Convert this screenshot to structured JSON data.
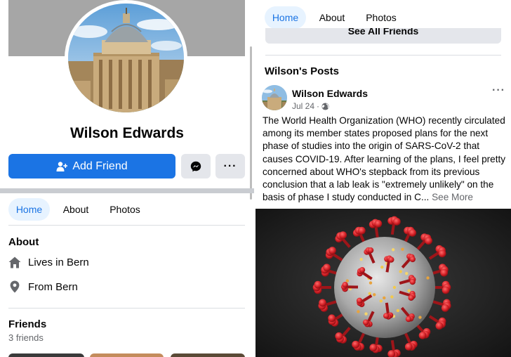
{
  "profile": {
    "name": "Wilson Edwards",
    "add_friend_label": "Add Friend",
    "more_label": "···"
  },
  "tabs": [
    {
      "label": "Home"
    },
    {
      "label": "About"
    },
    {
      "label": "Photos"
    }
  ],
  "about": {
    "title": "About",
    "lives_in_prefix": "Lives in ",
    "lives_in_place": "Bern",
    "from_prefix": "From ",
    "from_place": "Bern"
  },
  "friends": {
    "title": "Friends",
    "count_text": "3 friends",
    "see_all_label": "See All Friends"
  },
  "posts": {
    "title": "Wilson's Posts",
    "items": [
      {
        "author": "Wilson Edwards",
        "date": "Jul 24",
        "separator": "·",
        "menu_label": "···",
        "text": "The World Health Organization (WHO) recently circulated among its member states proposed plans for the next phase of studies into the origin of SARS-CoV-2 that causes COVID-19. After learning of the plans, I feel pretty concerned about WHO's stepback from its previous conclusion that a lab leak is \"extremely unlikely\" on the basis of phase I study conducted in C...",
        "see_more_label": "See More"
      }
    ]
  },
  "icons": {
    "add_friend": "person-plus-icon",
    "messenger": "messenger-icon",
    "home": "home-icon",
    "location": "location-pin-icon",
    "globe": "globe-icon"
  },
  "colors": {
    "accent": "#1b74e4",
    "tab_active_bg": "#e7f3ff",
    "secondary_button_bg": "#e4e6eb",
    "muted_text": "#65676b"
  }
}
